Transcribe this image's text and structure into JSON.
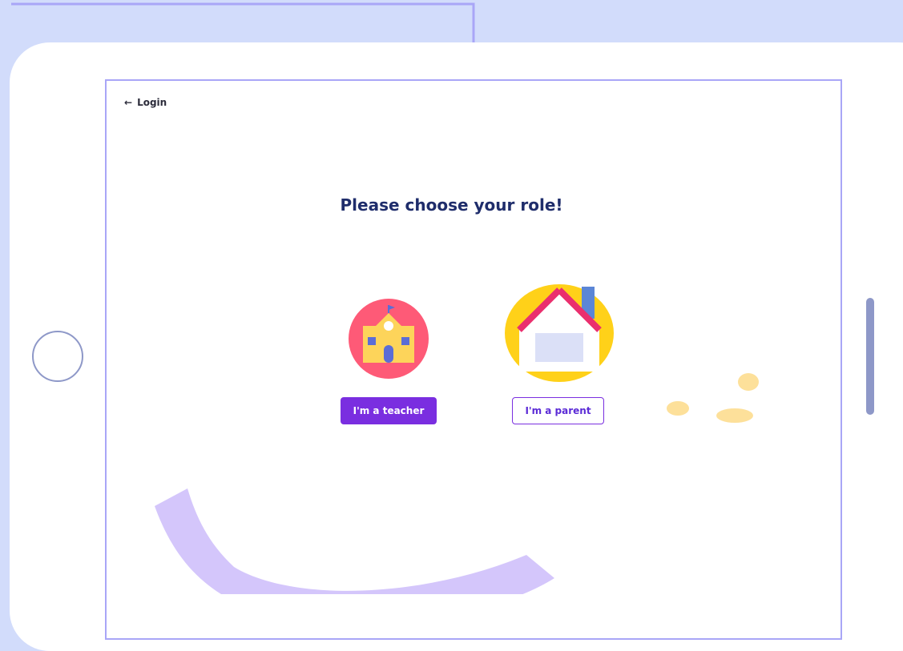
{
  "nav": {
    "back_label": "Login"
  },
  "main": {
    "title": "Please choose your role!"
  },
  "roles": [
    {
      "label": "I'm a teacher",
      "icon": "school-icon"
    },
    {
      "label": "I'm a parent",
      "icon": "house-icon"
    }
  ],
  "colors": {
    "background": "#d2dcfb",
    "frame": "#a9a6f7",
    "primary": "#7a2ee0",
    "title": "#1f2d6b"
  }
}
